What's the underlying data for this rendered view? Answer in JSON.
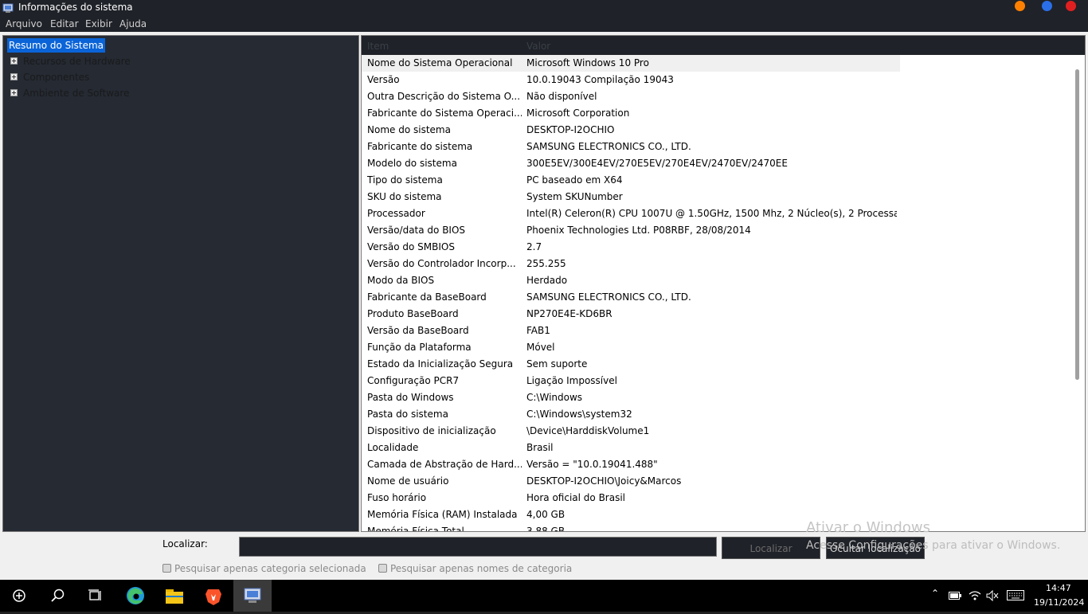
{
  "window": {
    "title": "Informações do sistema",
    "controls": [
      {
        "name": "minimize",
        "color": "#ff8000"
      },
      {
        "name": "maximize",
        "color": "#2a6fe8"
      },
      {
        "name": "close",
        "color": "#e02020"
      }
    ]
  },
  "menu": [
    "Arquivo",
    "Editar",
    "Exibir",
    "Ajuda"
  ],
  "tree": {
    "selected": "Resumo do Sistema",
    "items": [
      "Recursos de Hardware",
      "Componentes",
      "Ambiente de Software"
    ]
  },
  "list": {
    "headers": {
      "item": "Item",
      "value": "Valor"
    },
    "rows": [
      {
        "k": "Nome do Sistema Operacional",
        "v": "Microsoft Windows 10 Pro"
      },
      {
        "k": "Versão",
        "v": "10.0.19043 Compilação 19043"
      },
      {
        "k": "Outra Descrição do Sistema O...",
        "v": "Não disponível"
      },
      {
        "k": "Fabricante do Sistema Operaci...",
        "v": "Microsoft Corporation"
      },
      {
        "k": "Nome do sistema",
        "v": "DESKTOP-I2OCHIO"
      },
      {
        "k": "Fabricante do sistema",
        "v": "SAMSUNG ELECTRONICS CO., LTD."
      },
      {
        "k": "Modelo do sistema",
        "v": "300E5EV/300E4EV/270E5EV/270E4EV/2470EV/2470EE"
      },
      {
        "k": "Tipo do sistema",
        "v": "PC baseado em X64"
      },
      {
        "k": "SKU do sistema",
        "v": "System SKUNumber"
      },
      {
        "k": "Processador",
        "v": "Intel(R) Celeron(R) CPU 1007U @ 1.50GHz, 1500 Mhz, 2 Núcleo(s), 2 Processa..."
      },
      {
        "k": "Versão/data do BIOS",
        "v": "Phoenix Technologies Ltd. P08RBF, 28/08/2014"
      },
      {
        "k": "Versão do SMBIOS",
        "v": "2.7"
      },
      {
        "k": "Versão do Controlador Incorp...",
        "v": "255.255"
      },
      {
        "k": "Modo da BIOS",
        "v": "Herdado"
      },
      {
        "k": "Fabricante da BaseBoard",
        "v": "SAMSUNG ELECTRONICS CO., LTD."
      },
      {
        "k": "Produto BaseBoard",
        "v": "NP270E4E-KD6BR"
      },
      {
        "k": "Versão da BaseBoard",
        "v": "FAB1"
      },
      {
        "k": "Função da Plataforma",
        "v": "Móvel"
      },
      {
        "k": "Estado da Inicialização Segura",
        "v": "Sem suporte"
      },
      {
        "k": "Configuração PCR7",
        "v": "Ligação Impossível"
      },
      {
        "k": "Pasta do Windows",
        "v": "C:\\Windows"
      },
      {
        "k": "Pasta do sistema",
        "v": "C:\\Windows\\system32"
      },
      {
        "k": "Dispositivo de inicialização",
        "v": "\\Device\\HarddiskVolume1"
      },
      {
        "k": "Localidade",
        "v": "Brasil"
      },
      {
        "k": "Camada de Abstração de Hard...",
        "v": "Versão = \"10.0.19041.488\""
      },
      {
        "k": "Nome de usuário",
        "v": "DESKTOP-I2OCHIO\\Joicy&Marcos"
      },
      {
        "k": "Fuso horário",
        "v": "Hora oficial do Brasil"
      },
      {
        "k": "Memória Física (RAM) Instalada",
        "v": "4,00 GB"
      },
      {
        "k": "Memória Física Total",
        "v": "3,88 GB"
      }
    ]
  },
  "find": {
    "label": "Localizar:",
    "value": "",
    "find_button": "Localizar",
    "hide_button": "Ocultar localização",
    "check_selected": "Pesquisar apenas categoria selecionada",
    "check_names": "Pesquisar apenas nomes de categoria"
  },
  "watermark": {
    "title": "Ativar o Windows",
    "subtitle": "Acesse Configurações para ativar o Windows."
  },
  "taskbar": {
    "apps": [
      "start-icon",
      "search-icon",
      "task-view-icon",
      "edge-icon",
      "file-explorer-icon",
      "brave-icon",
      "msinfo-icon"
    ],
    "time": "14:47",
    "date": "19/11/2024"
  }
}
